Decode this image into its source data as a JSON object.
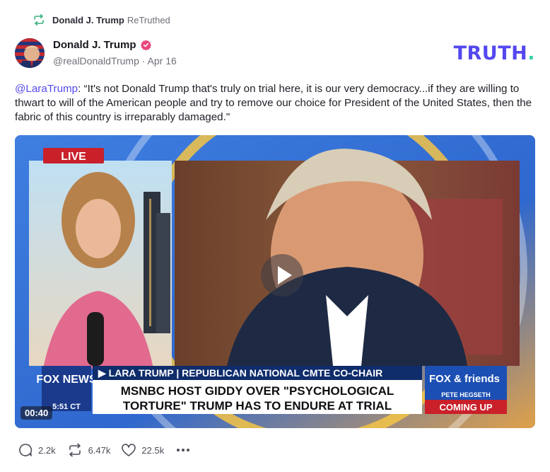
{
  "retruth": {
    "name": "Donald J. Trump",
    "verb": "ReTruthed"
  },
  "author": {
    "display_name": "Donald J. Trump",
    "handle": "@realDonaldTrump",
    "separator": "·",
    "date": "Apr 16"
  },
  "brand": {
    "logo_text": "TRUTH",
    "logo_dot": ".",
    "accent": "#5448ee",
    "dot_color": "#39d2a8"
  },
  "post": {
    "mention": "@LaraTrump",
    "body": ": “It's not Donald Trump that's truly on trial here, it is our very democracy...if they are willing to thwart to will of the American people and try to remove our choice for President of the United States, then the fabric of this country is irreparably damaged.\""
  },
  "video": {
    "duration": "00:40",
    "live_badge": "LIVE",
    "network": "FOX NEWS",
    "clock": "5:51 CT",
    "lower_third_top": "▶ LARA TRUMP | REPUBLICAN NATIONAL CMTE CO-CHAIR",
    "headline_line1": "MSNBC HOST GIDDY OVER \"PSYCHOLOGICAL",
    "headline_line2": "TORTURE\" TRUMP HAS TO ENDURE AT TRIAL",
    "promo_show": "FOX & friends",
    "promo_name": "PETE HEGSETH",
    "promo_cta": "COMING UP"
  },
  "actions": {
    "replies": "2.2k",
    "retruths": "6.47k",
    "likes": "22.5k"
  },
  "icons": {
    "retruth": "retruth-icon",
    "verified": "verified-badge-icon",
    "reply": "reply-icon",
    "like": "heart-icon",
    "more": "more-icon",
    "play": "play-icon"
  }
}
